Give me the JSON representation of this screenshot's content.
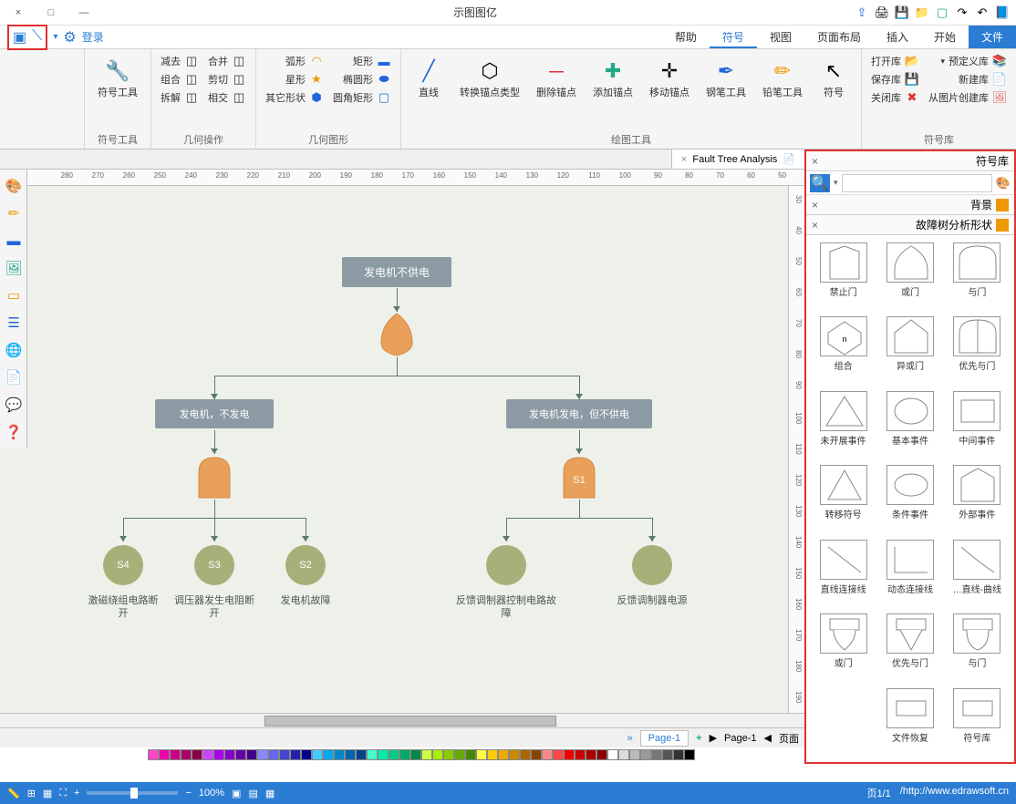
{
  "title": "示图图亿",
  "window": {
    "min": "—",
    "max": "□",
    "close": "×"
  },
  "menubar": {
    "file": "文件",
    "start": "开始",
    "insert": "插入",
    "layout": "页面布局",
    "view": "视图",
    "symbol": "符号",
    "help": "帮助",
    "login": "登录"
  },
  "ribbon": {
    "group_symbol_lib": {
      "label": "符号库",
      "items": {
        "predef": "预定义库",
        "open": "打开库",
        "save": "保存库",
        "new": "新建库",
        "close": "关闭库",
        "from_img": "从图片创建库"
      }
    },
    "group_draw_tools": {
      "label": "绘图工具",
      "items": {
        "symbol": "符号",
        "pencil": "铅笔工具",
        "pen": "钢笔工具",
        "move_anchor": "移动锚点",
        "add_anchor": "添加锚点",
        "del_anchor": "删除锚点",
        "convert_type": "转换锚点类型",
        "line": "直线"
      }
    },
    "group_shapes": {
      "label": "几何图形",
      "items": {
        "rect": "矩形",
        "ellipse": "椭圆形",
        "rrect": "圆角矩形",
        "arc": "弧形",
        "star": "星形",
        "other": "其它形状"
      }
    },
    "group_geom_ops": {
      "label": "几何操作",
      "items": {
        "merge": "合并",
        "split": "剪切",
        "intersect": "相交",
        "subtract": "减去",
        "combine": "组合",
        "break": "拆解"
      }
    },
    "group_sym_tool": {
      "label": "符号工具",
      "item": "符号工具"
    }
  },
  "shapes_panel": {
    "title": "符号库",
    "bg_title": "背景",
    "section": "故障树分析形状",
    "shapes": [
      "与门",
      "或门",
      "禁止门",
      "优先与门",
      "异或门",
      "组合",
      "中间事件",
      "基本事件",
      "未开展事件",
      "外部事件",
      "条件事件",
      "转移符号",
      "直线-曲线…",
      "动态连接线",
      "直线连接线",
      "与门",
      "优先与门",
      "或门",
      "符号库",
      "文件恢复"
    ]
  },
  "doc_tab": {
    "name": "Fault Tree Analysis",
    "close": "×"
  },
  "canvas": {
    "root": "发电机不供电",
    "left_fault": "发电机发电，但不供电",
    "right_fault": "发电机，不发电",
    "gate_s1": "S1",
    "leaves": [
      {
        "id": "",
        "label": "反馈调制器电源"
      },
      {
        "id": "",
        "label": "反馈调制器控制电路故障"
      },
      {
        "id": "S2",
        "label": "发电机故障"
      },
      {
        "id": "S3",
        "label": "调压器发生电阻断开"
      },
      {
        "id": "S4",
        "label": "激磁绕组电路断开"
      }
    ]
  },
  "page_tabs": {
    "control": "页面",
    "p1": "Page-1",
    "p1b": "Page-1",
    "add": "+"
  },
  "statusbar": {
    "url": "http://www.edrawsoft.cn/",
    "pages": "页1/1",
    "zoom": "100%"
  },
  "ruler_marks": [
    50,
    60,
    70,
    80,
    90,
    100,
    110,
    120,
    130,
    140,
    150,
    160,
    170,
    180,
    190,
    200,
    210,
    220,
    230,
    240,
    250,
    260,
    270,
    280
  ],
  "ruler_v_marks": [
    30,
    40,
    50,
    60,
    70,
    80,
    90,
    100,
    110,
    120,
    130,
    140,
    150,
    160,
    170,
    180,
    190
  ]
}
